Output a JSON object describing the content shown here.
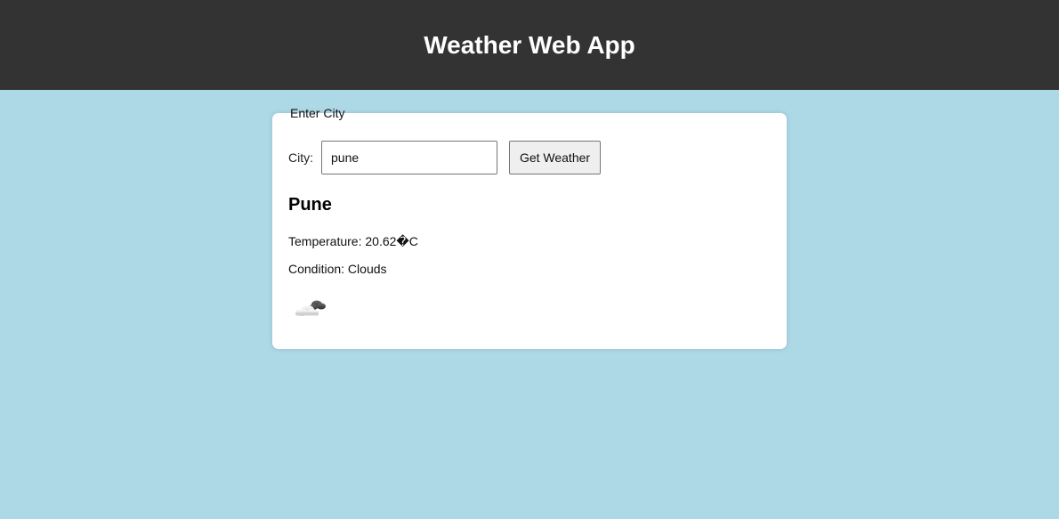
{
  "header": {
    "title": "Weather Web App"
  },
  "form": {
    "legend": "Enter City",
    "city_label": "City:",
    "city_value": "pune",
    "submit_label": "Get Weather"
  },
  "result": {
    "city": "Pune",
    "temperature_text": "Temperature: 20.62�C",
    "condition_text": "Condition: Clouds",
    "icon": "cloud-icon"
  }
}
